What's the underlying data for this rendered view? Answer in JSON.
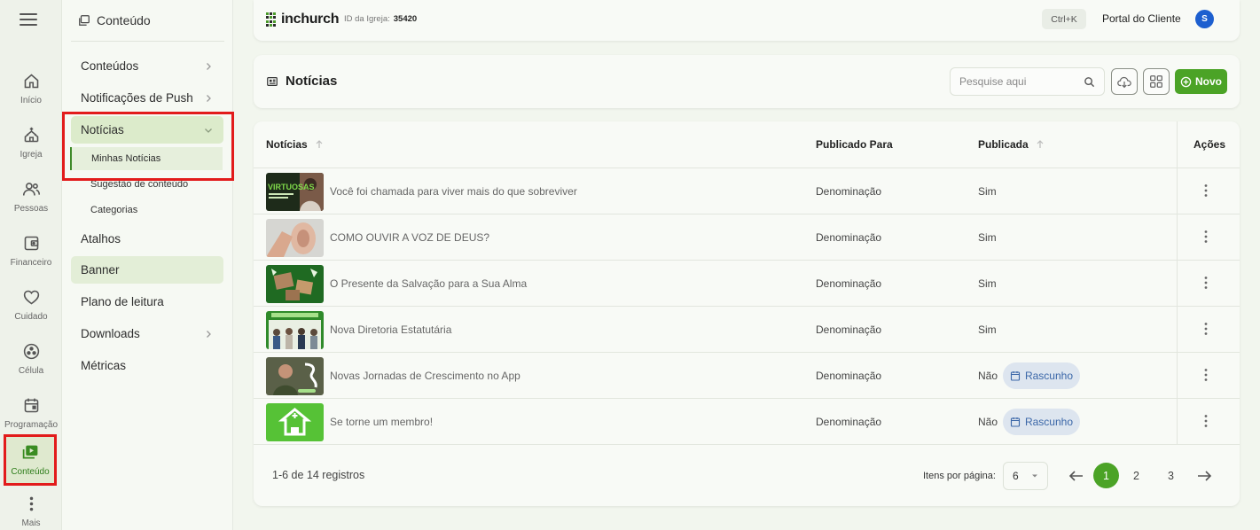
{
  "rail": {
    "items": [
      {
        "label": "Início"
      },
      {
        "label": "Igreja"
      },
      {
        "label": "Pessoas"
      },
      {
        "label": "Financeiro"
      },
      {
        "label": "Cuidado"
      },
      {
        "label": "Célula"
      },
      {
        "label": "Programação"
      },
      {
        "label": "Conteúdo"
      },
      {
        "label": "Mais"
      }
    ],
    "active": "Conteúdo"
  },
  "sidebar": {
    "title": "Conteúdo",
    "items": [
      {
        "label": "Conteúdos"
      },
      {
        "label": "Notificações de Push"
      },
      {
        "label": "Notícias"
      },
      {
        "label": "Atalhos"
      },
      {
        "label": "Banner"
      },
      {
        "label": "Plano de leitura"
      },
      {
        "label": "Downloads"
      },
      {
        "label": "Métricas"
      }
    ],
    "subitems": [
      {
        "label": "Minhas Notícias"
      },
      {
        "label": "Sugestão de conteúdo"
      },
      {
        "label": "Categorias"
      }
    ]
  },
  "header": {
    "logo_text": "inchurch",
    "church_id_label": "ID da Igreja:",
    "church_id": "35420",
    "shortcut": "Ctrl+K",
    "portal_label": "Portal do Cliente",
    "avatar_initial": "S"
  },
  "page": {
    "title": "Notícias",
    "search_placeholder": "Pesquise aqui",
    "new_button": "Novo"
  },
  "table": {
    "columns": [
      "Notícias",
      "Publicado Para",
      "Publicada",
      "Ações"
    ],
    "rows": [
      {
        "title": "Você foi chamada para viver mais do que sobreviver",
        "published_to": "Denominação",
        "published": "Sim",
        "status": ""
      },
      {
        "title": "COMO OUVIR A VOZ DE DEUS?",
        "published_to": "Denominação",
        "published": "Sim",
        "status": ""
      },
      {
        "title": "O Presente da Salvação para a Sua Alma",
        "published_to": "Denominação",
        "published": "Sim",
        "status": ""
      },
      {
        "title": "Nova Diretoria Estatutária",
        "published_to": "Denominação",
        "published": "Sim",
        "status": ""
      },
      {
        "title": "Novas Jornadas de Crescimento no App",
        "published_to": "Denominação",
        "published": "Não",
        "status": "Rascunho"
      },
      {
        "title": "Se torne um membro!",
        "published_to": "Denominação",
        "published": "Não",
        "status": "Rascunho"
      }
    ],
    "thumb_texts": {
      "row0": "VIRTUOSAS"
    }
  },
  "pagination": {
    "count_text": "1-6 de 14 registros",
    "per_page_label": "Itens por página:",
    "per_page_value": "6",
    "pages": [
      "1",
      "2",
      "3"
    ],
    "current_page": "1"
  },
  "colors": {
    "accent": "#4ba326",
    "highlight": "#e21b1b",
    "draft_bg": "#dde5ef"
  }
}
